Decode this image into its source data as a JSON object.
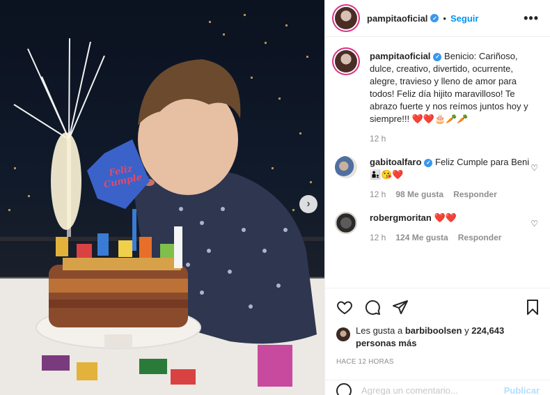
{
  "post": {
    "author": "pampitaoficial",
    "follow_label": "Seguir",
    "dot": "•",
    "more_label": "•••",
    "caption": "Benicio: Cariñoso, dulce, creativo, divertido, ocurrente, alegre, travieso y lleno de amor para todos! Feliz día hijito maravilloso! Te abrazo fuerte y nos reímos juntos hoy y siempre!!! ❤️❤️🎂🥕🥕",
    "caption_time": "12 h",
    "cake_topper": "Feliz Cumple"
  },
  "comments": [
    {
      "user": "gabitoalfaro",
      "verified": true,
      "text": "Feliz Cumple para Beni 👨‍👦😘❤️",
      "time": "12 h",
      "likes": "98 Me gusta",
      "reply": "Responder"
    },
    {
      "user": "robergmoritan",
      "verified": false,
      "text": "❤️❤️",
      "time": "12 h",
      "likes": "124 Me gusta",
      "reply": "Responder"
    }
  ],
  "likes": {
    "prefix": "Les gusta a",
    "first_user": "barbiboolsen",
    "connector": "y",
    "count_text": "224,643 personas más"
  },
  "timestamp": "HACE 12 HORAS",
  "add_comment": {
    "placeholder": "Agrega un comentario...",
    "post_label": "Publicar"
  },
  "colors": {
    "accent": "#0095f6",
    "verified": "#3897f0",
    "muted": "#8e8e8e",
    "heart": "#ed4956"
  },
  "icons": [
    "heart-icon",
    "comment-icon",
    "share-icon",
    "bookmark-icon",
    "more-icon",
    "emoji-icon",
    "chevron-right-icon"
  ]
}
